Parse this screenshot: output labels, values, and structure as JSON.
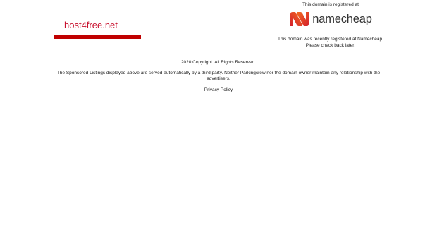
{
  "domain": {
    "name": "host4free.net",
    "accent_color": "#c8102e",
    "bar_color": "#c00000"
  },
  "registrar": {
    "registered_at_text": "This domain is registered at",
    "logo_icon": "namecheap-n-logo",
    "logo_text": "namecheap",
    "note_line1": "This domain was recently registered at Namecheap.",
    "note_line2": "Please check back later!",
    "brand_color": "#de3723"
  },
  "footer": {
    "copyright": "2020 Copyright. All Rights Reserved.",
    "sponsored": "The Sponsored Listings displayed above are served automatically by a third party. Neither Parkingcrew nor the domain owner maintain any relationship with the advertisers.",
    "privacy_link": "Privacy Policy"
  }
}
